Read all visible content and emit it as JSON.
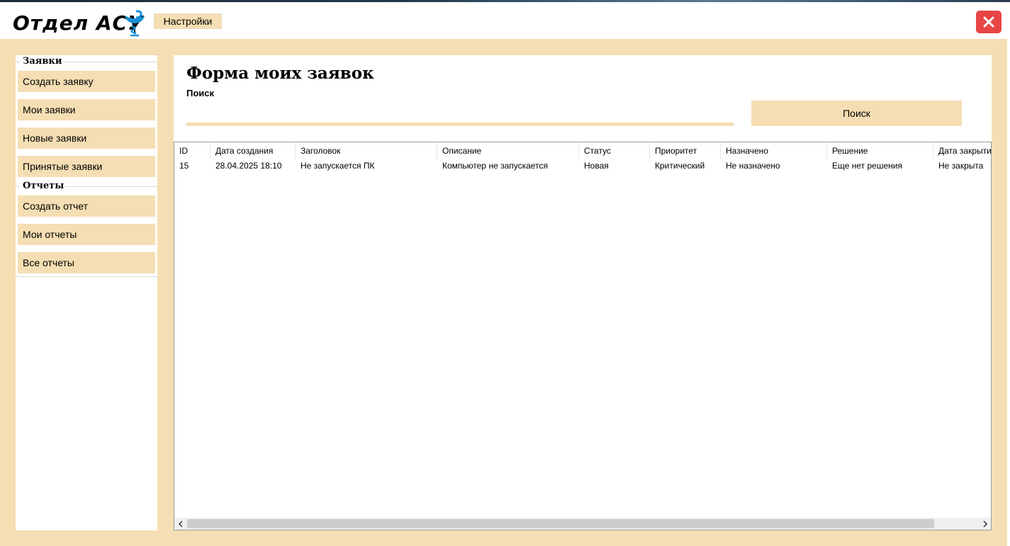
{
  "app": {
    "title": "Отдел АСУ",
    "logo_icon": "medical-bowl-snake-icon",
    "settings_label": "Настройки",
    "close_icon": "close-icon",
    "close_color": "#e84545"
  },
  "colors": {
    "background": "#f5deb3",
    "panel": "#ffffff"
  },
  "sidebar": {
    "groups": [
      {
        "title": "Заявки",
        "items": [
          {
            "label": "Создать заявку"
          },
          {
            "label": "Мои заявки"
          },
          {
            "label": "Новые заявки"
          },
          {
            "label": "Принятые заявки"
          }
        ]
      },
      {
        "title": "Отчеты",
        "items": [
          {
            "label": "Создать отчет"
          },
          {
            "label": "Мои отчеты"
          },
          {
            "label": "Все отчеты"
          }
        ]
      }
    ]
  },
  "main": {
    "title": "Форма моих заявок",
    "search_label": "Поиск",
    "search_value": "",
    "search_button": "Поиск"
  },
  "table": {
    "columns": [
      "ID",
      "Дата создания",
      "Заголовок",
      "Описание",
      "Статус",
      "Приоритет",
      "Назначено",
      "Решение",
      "Дата закрытия"
    ],
    "rows": [
      [
        "15",
        "28.04.2025 18:10",
        "Не запускается ПК",
        "Компьютер не запускается",
        "Новая",
        "Критический",
        "Не назначено",
        "Еще нет решения",
        "Не закрыта"
      ]
    ]
  }
}
